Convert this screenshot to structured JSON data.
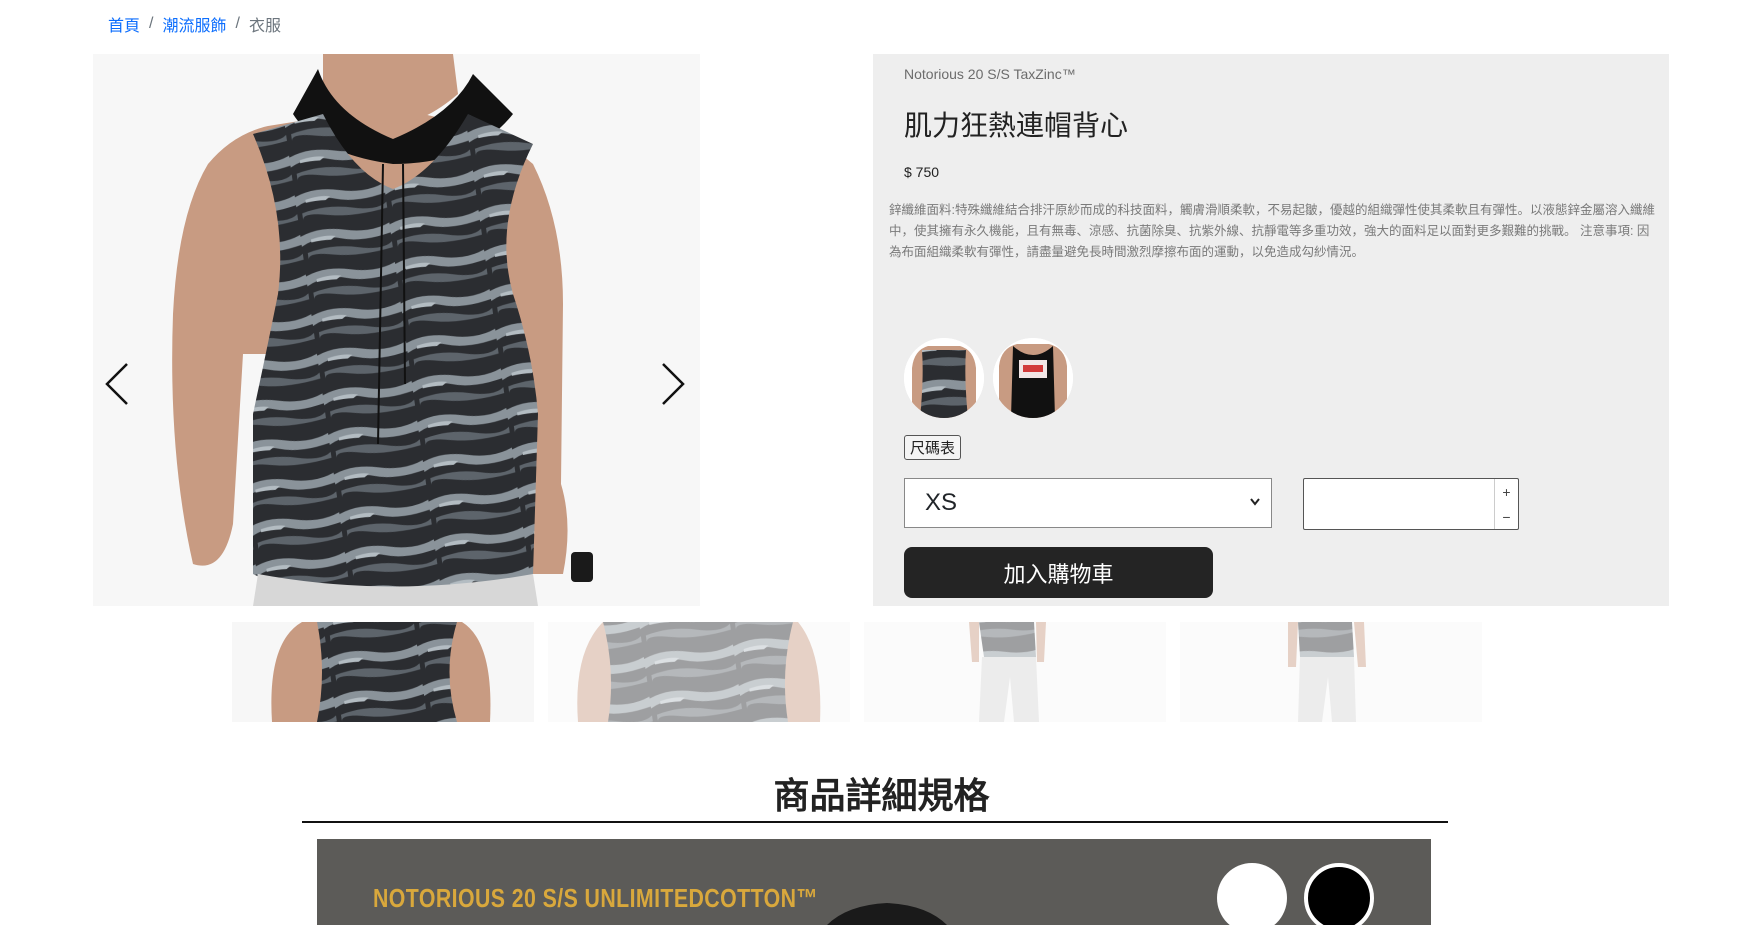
{
  "breadcrumb": {
    "home": "首頁",
    "category": "潮流服飾",
    "current": "衣服",
    "separator": "/"
  },
  "product": {
    "brand_line": "Notorious 20 S/S TaxZinc™",
    "title": "肌力狂熱連帽背心",
    "price": "$ 750",
    "description": "鋅纖維面料:特殊纖維結合排汗原紗而成的科技面料，觸膚滑順柔軟，不易起皺，優越的組織彈性使其柔軟且有彈性。以液態鋅金屬溶入纖維中，使其擁有永久機能，且有無毒、涼感、抗菌除臭、抗紫外線、抗靜電等多重功效，強大的面料足以面對更多艱難的挑戰。 注意事項: 因為布面組織柔軟有彈性，請盡量避免長時間激烈摩擦布面的運動，以免造成勾紗情況。"
  },
  "swatches": [
    {
      "name": "camo-hoodie-vest",
      "color": "#3a3d42"
    },
    {
      "name": "black-tank",
      "color": "#111111"
    }
  ],
  "size_chart_label": "尺碼表",
  "size_select": {
    "selected": "XS"
  },
  "quantity": {
    "value": "",
    "plus": "+",
    "minus": "−"
  },
  "add_to_cart_label": "加入購物車",
  "spec_section_title": "商品詳細規格",
  "banner": {
    "text": "NOTORIOUS 20 S/S UNLIMITEDCOTTON™"
  },
  "icons": {
    "prev": "chevron-left-icon",
    "next": "chevron-right-icon",
    "select": "chevron-down-icon"
  }
}
